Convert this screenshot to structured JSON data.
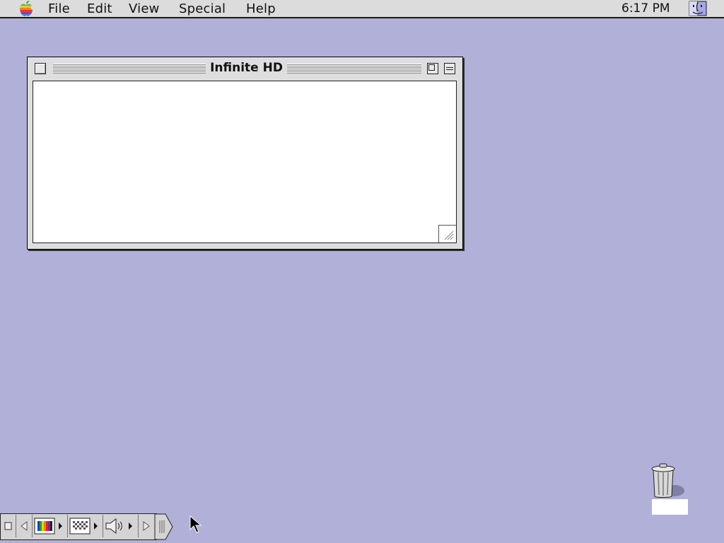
{
  "menubar": {
    "apple_icon": "rainbow-apple-icon",
    "items": [
      "File",
      "Edit",
      "View",
      "Special",
      "Help"
    ],
    "clock": "6:17 PM",
    "app_icon": "finder-face-icon"
  },
  "window": {
    "title": "Infinite HD",
    "close_icon": "close-box-icon",
    "zoom_icon": "zoom-box-icon",
    "collapse_icon": "collapse-box-icon",
    "grow_icon": "resize-grip-icon"
  },
  "desktop": {
    "background_color": "#b0b0d8",
    "trash_icon": "trash-can-icon",
    "trash_label": ""
  },
  "control_strip": {
    "items": [
      "strip-collapse-icon",
      "scroll-left-icon",
      "monitor-bit-depth-icon",
      "monitor-resolution-icon",
      "sound-volume-icon",
      "scroll-right-icon",
      "strip-tab-icon"
    ]
  }
}
